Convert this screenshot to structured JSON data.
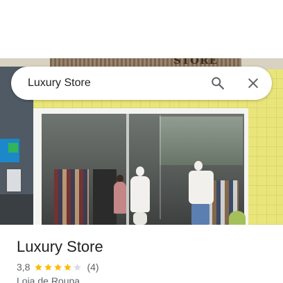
{
  "photo": {
    "sign_text": "STORE"
  },
  "search": {
    "query": "Luxury Store",
    "search_icon": "search-icon",
    "close_icon": "close-icon"
  },
  "place": {
    "name": "Luxury Store",
    "rating_text": "3,8",
    "rating_value": 3.8,
    "rating_max": 5,
    "review_count": "(4)",
    "category": "Loja de Roupa"
  },
  "colors": {
    "star_filled": "#fbbc04",
    "star_empty": "#dadce0",
    "icon": "#5f6368",
    "title": "#202124"
  }
}
